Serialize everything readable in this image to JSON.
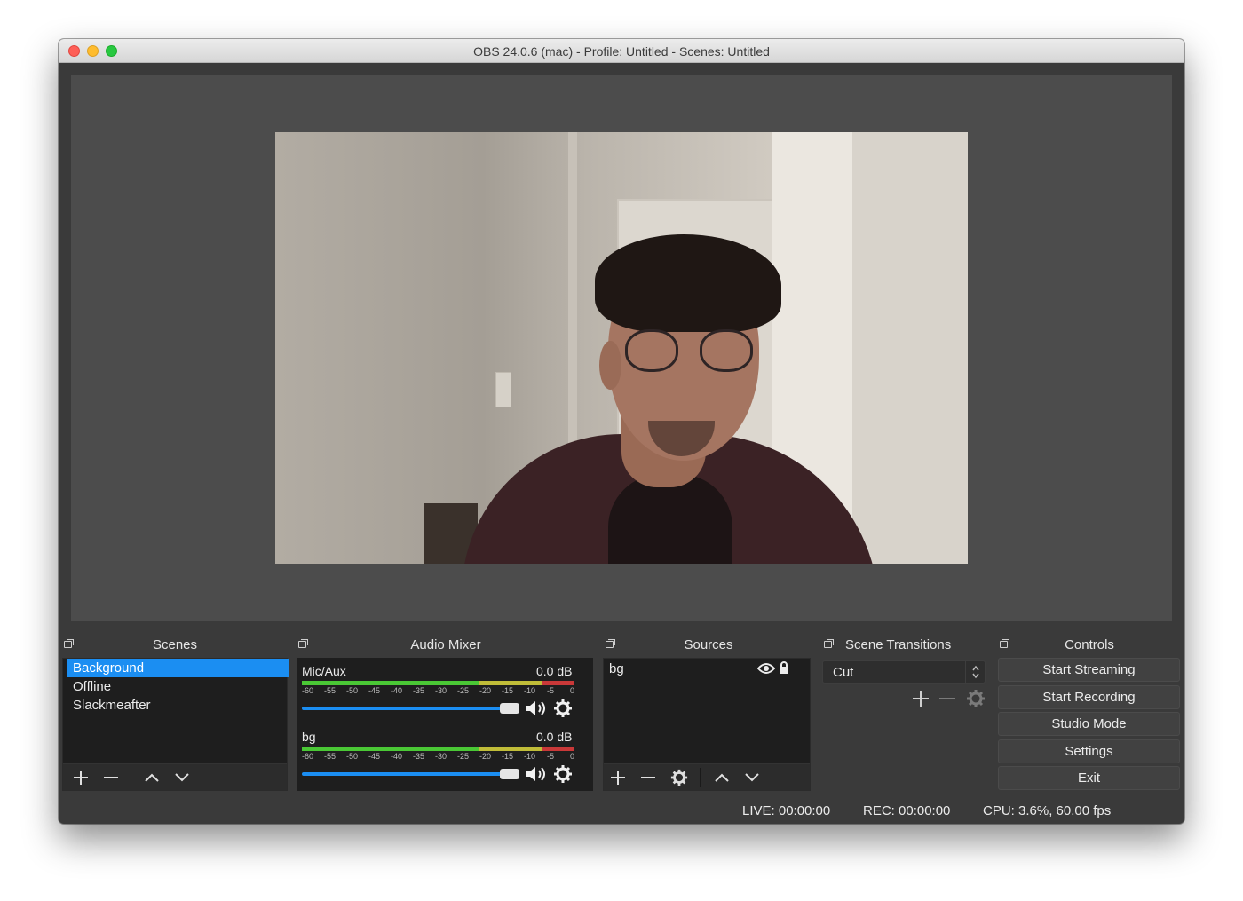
{
  "window": {
    "title": "OBS 24.0.6 (mac) - Profile: Untitled - Scenes: Untitled"
  },
  "preview": {
    "source": "camera-feed"
  },
  "docks": {
    "scenes": {
      "title": "Scenes",
      "items": [
        {
          "label": "Background",
          "selected": true
        },
        {
          "label": "Offline",
          "selected": false
        },
        {
          "label": "Slackmeafter",
          "selected": false
        }
      ],
      "toolbar": [
        "plus-icon",
        "minus-icon",
        "up-arrow-icon",
        "down-arrow-icon"
      ]
    },
    "audio_mixer": {
      "title": "Audio Mixer",
      "channels": [
        {
          "name": "Mic/Aux",
          "db": "0.0 dB",
          "volume_percent": 100
        },
        {
          "name": "bg",
          "db": "0.0 dB",
          "volume_percent": 100
        }
      ],
      "ticks": [
        "-60",
        "-55",
        "-50",
        "-45",
        "-40",
        "-35",
        "-30",
        "-25",
        "-20",
        "-15",
        "-10",
        "-5",
        "0"
      ]
    },
    "sources": {
      "title": "Sources",
      "items": [
        {
          "label": "bg",
          "visible": true,
          "locked": true
        }
      ],
      "toolbar": [
        "plus-icon",
        "minus-icon",
        "gear-icon",
        "up-arrow-icon",
        "down-arrow-icon"
      ]
    },
    "scene_transitions": {
      "title": "Scene Transitions",
      "selected": "Cut"
    },
    "controls": {
      "title": "Controls",
      "buttons": {
        "start_streaming": "Start Streaming",
        "start_recording": "Start Recording",
        "studio_mode": "Studio Mode",
        "settings": "Settings",
        "exit": "Exit"
      }
    }
  },
  "status": {
    "live": "LIVE: 00:00:00",
    "rec": "REC: 00:00:00",
    "cpu": "CPU: 3.6%, 60.00 fps"
  },
  "colors": {
    "accent": "#1b8ef2",
    "background": "#3a3a3a",
    "panel": "#1e1e1e"
  }
}
